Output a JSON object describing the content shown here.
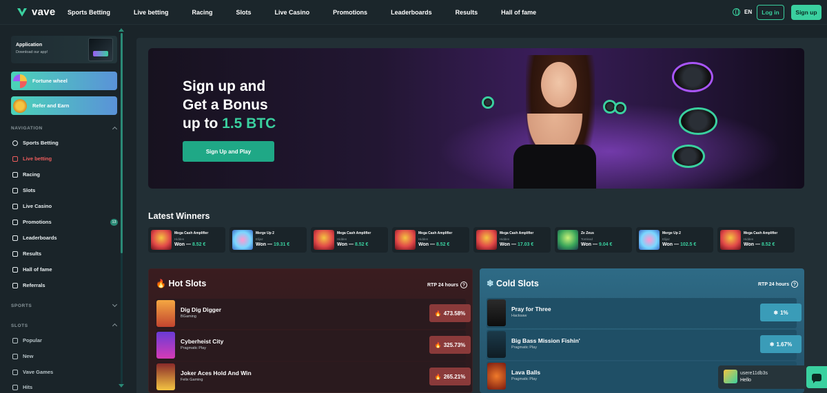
{
  "header": {
    "logo_text": "vave",
    "nav": [
      "Sports Betting",
      "Live betting",
      "Racing",
      "Slots",
      "Live Casino",
      "Promotions",
      "Leaderboards",
      "Results",
      "Hall of fame"
    ],
    "lang": "EN",
    "login": "Log in",
    "signup": "Sign up"
  },
  "sidebar": {
    "app": {
      "title": "Application",
      "subtitle": "Download our app!"
    },
    "fortune": "Fortune wheel",
    "refer": "Refer and Earn",
    "navigation_head": "NAVIGATION",
    "nav_items": [
      {
        "label": "Sports Betting",
        "icon": "soccer-ball-icon"
      },
      {
        "label": "Live betting",
        "icon": "live-icon"
      },
      {
        "label": "Racing",
        "icon": "horse-icon"
      },
      {
        "label": "Slots",
        "icon": "slot-icon"
      },
      {
        "label": "Live Casino",
        "icon": "chip-icon"
      },
      {
        "label": "Promotions",
        "icon": "promo-icon"
      },
      {
        "label": "Leaderboards",
        "icon": "leaderboard-icon"
      },
      {
        "label": "Results",
        "icon": "flag-icon"
      },
      {
        "label": "Hall of fame",
        "icon": "trophy-icon"
      },
      {
        "label": "Referrals",
        "icon": "referrals-icon"
      }
    ],
    "promotions_badge": "13",
    "sports_head": "SPORTS",
    "slots_head": "SLOTS",
    "slot_items": [
      "Popular",
      "New",
      "Vave Games",
      "Hits"
    ]
  },
  "hero": {
    "line1": "Sign up and",
    "line2": "Get a Bonus",
    "line3_prefix": "up to ",
    "line3_accent": "1.5 BTC",
    "button": "Sign Up and Play"
  },
  "latest_winners": {
    "title": "Latest Winners",
    "won_prefix": "Won —",
    "items": [
      {
        "game": "Mega Cash Amplifier",
        "user": "Hidden",
        "amount": "8.52 €",
        "thumb": "mega"
      },
      {
        "game": "Merge Up 2",
        "user": "Elijaz",
        "amount": "19.31 €",
        "thumb": "merge"
      },
      {
        "game": "Mega Cash Amplifier",
        "user": "Hidden",
        "amount": "8.52 €",
        "thumb": "mega"
      },
      {
        "game": "Mega Cash Amplifier",
        "user": "Hidden",
        "amount": "8.52 €",
        "thumb": "mega"
      },
      {
        "game": "Mega Cash Amplifier",
        "user": "Hidden",
        "amount": "17.03 €",
        "thumb": "mega"
      },
      {
        "game": "Ze Zeus",
        "user": "Tomlead",
        "amount": "9.04 €",
        "thumb": "zeus"
      },
      {
        "game": "Merge Up 2",
        "user": "Elijaz",
        "amount": "102.5 €",
        "thumb": "merge"
      },
      {
        "game": "Mega Cash Amplifier",
        "user": "Hidden",
        "amount": "8.52 €",
        "thumb": "mega"
      }
    ]
  },
  "hot_slots": {
    "title": "Hot Slots",
    "rtp": "RTP 24 hours",
    "rows": [
      {
        "name": "Dig Dig Digger",
        "provider": "BGaming",
        "value": "473.58%"
      },
      {
        "name": "Cyberheist City",
        "provider": "Pragmatic Play",
        "value": "325.73%"
      },
      {
        "name": "Joker Aces Hold And Win",
        "provider": "Felix Gaming",
        "value": "265.21%"
      }
    ]
  },
  "cold_slots": {
    "title": "Cold Slots",
    "rtp": "RTP 24 hours",
    "rows": [
      {
        "name": "Pray for Three",
        "provider": "Hacksaw",
        "value": "1%"
      },
      {
        "name": "Big Bass Mission Fishin'",
        "provider": "Pragmatic Play",
        "value": "1.67%"
      },
      {
        "name": "Lava Balls",
        "provider": "Pragmatic Play",
        "value": ""
      }
    ]
  },
  "chat": {
    "user": "usere11db3s",
    "message": "Hello"
  },
  "colors": {
    "accent": "#3ad09f",
    "live": "#ef5d5d",
    "hot_pill": "#8a3a3a",
    "cold_pill": "#3a9cb8"
  }
}
